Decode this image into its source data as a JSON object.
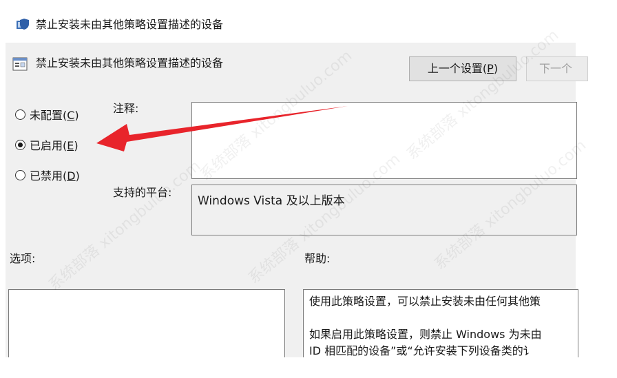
{
  "window": {
    "title": "禁止安装未由其他策略设置描述的设备"
  },
  "header": {
    "title": "禁止安装未由其他策略设置描述的设备",
    "prev_button": "上一个设置(P)",
    "next_button": "下一个"
  },
  "radios": [
    {
      "label": "未配置(C)",
      "checked": false
    },
    {
      "label": "已启用(E)",
      "checked": true
    },
    {
      "label": "已禁用(D)",
      "checked": false
    }
  ],
  "comment": {
    "label": "注释:",
    "value": ""
  },
  "platform": {
    "label": "支持的平台:",
    "value": "Windows Vista 及以上版本"
  },
  "options": {
    "label": "选项:"
  },
  "help": {
    "label": "帮助:",
    "lines": [
      "使用此策略设置，可以禁止安装未由任何其他策",
      "如果启用此策略设置，则禁止 Windows 为未由",
      "ID 相匹配的设备”或“允许安装下列设备类的讠"
    ]
  },
  "watermark": {
    "text": "系统部落 xitongbuluo.com"
  },
  "colors": {
    "arrow": "#e8242b",
    "panel": "#f0f0f0",
    "button": "#e1e1e1"
  }
}
